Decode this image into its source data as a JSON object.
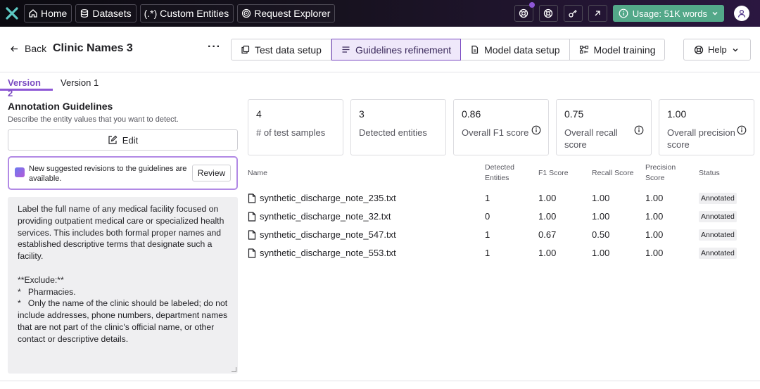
{
  "topnav": {
    "items": [
      {
        "label": "Home",
        "icon": "home-icon"
      },
      {
        "label": "Datasets",
        "icon": "database-icon"
      },
      {
        "label": "(.*) Custom Entities",
        "icon": ""
      },
      {
        "label": "Request Explorer",
        "icon": "target-icon"
      }
    ],
    "usage_label": "Usage: 51K words"
  },
  "header": {
    "back_label": "Back",
    "title": "Clinic Names 3",
    "more_label": "···",
    "steps": [
      {
        "label": "Test data setup"
      },
      {
        "label": "Guidelines refinement"
      },
      {
        "label": "Model data setup"
      },
      {
        "label": "Model training"
      }
    ],
    "help_label": "Help"
  },
  "versions": [
    "Version 2",
    "Version 1"
  ],
  "guidelines": {
    "title": "Annotation Guidelines",
    "subtitle": "Describe the entity values that you want to detect.",
    "edit_label": "Edit",
    "suggestion_text": "New suggested revisions to the guidelines are available.",
    "review_label": "Review",
    "body": "Label the full name of any medical facility focused on providing outpatient medical care or specialized health services. This includes both formal proper names and established descriptive terms that designate such a facility.\n\n**Exclude:**\n*   Pharmacies.\n*   Only the name of the clinic should be labeled; do not include addresses, phone numbers, department names that are not part of the clinic's official name, or other contact or descriptive details."
  },
  "metrics": [
    {
      "value": "4",
      "label": "# of test samples",
      "info": false
    },
    {
      "value": "3",
      "label": "Detected entities",
      "info": false
    },
    {
      "value": "0.86",
      "label": "Overall F1 score",
      "info": true
    },
    {
      "value": "0.75",
      "label": "Overall recall score",
      "info": true
    },
    {
      "value": "1.00",
      "label": "Overall precision score",
      "info": true
    }
  ],
  "table": {
    "headers": {
      "name": "Name",
      "detected": "Detected Entities",
      "f1": "F1 Score",
      "recall": "Recall Score",
      "precision": "Precision Score",
      "status": "Status"
    },
    "rows": [
      {
        "name": "synthetic_discharge_note_235.txt",
        "detected": "1",
        "f1": "1.00",
        "recall": "1.00",
        "precision": "1.00",
        "status": "Annotated"
      },
      {
        "name": "synthetic_discharge_note_32.txt",
        "detected": "0",
        "f1": "1.00",
        "recall": "1.00",
        "precision": "1.00",
        "status": "Annotated"
      },
      {
        "name": "synthetic_discharge_note_547.txt",
        "detected": "1",
        "f1": "0.67",
        "recall": "0.50",
        "precision": "1.00",
        "status": "Annotated"
      },
      {
        "name": "synthetic_discharge_note_553.txt",
        "detected": "1",
        "f1": "1.00",
        "recall": "1.00",
        "precision": "1.00",
        "status": "Annotated"
      }
    ]
  },
  "colors": {
    "accent": "#8e57d6",
    "usage": "#53a889",
    "topbar": "#0b0a10"
  }
}
